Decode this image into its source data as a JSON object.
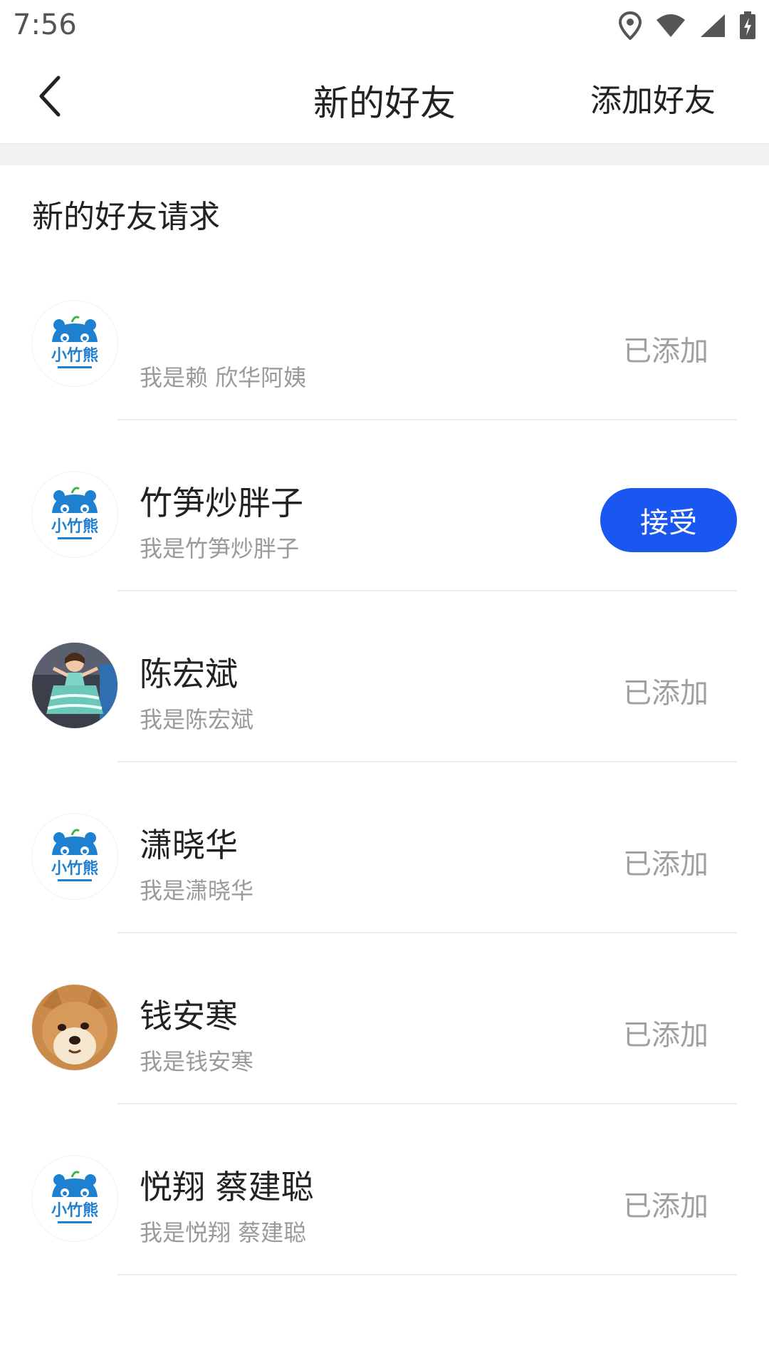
{
  "status_bar": {
    "time": "7:56",
    "icons": [
      "location-icon",
      "wifi-icon",
      "signal-icon",
      "battery-charging-icon"
    ]
  },
  "nav": {
    "back_icon": "chevron-left-icon",
    "title": "新的好友",
    "action_label": "添加好友"
  },
  "section": {
    "title": "新的好友请求"
  },
  "requests": [
    {
      "name": "",
      "message": "我是赖 欣华阿姨",
      "avatar": "xiaozhuxiong-logo",
      "status": "已添加"
    },
    {
      "name": "竹笋炒胖子",
      "message": "我是竹笋炒胖子",
      "avatar": "xiaozhuxiong-logo",
      "action": "接受"
    },
    {
      "name": "陈宏斌",
      "message": "我是陈宏斌",
      "avatar": "doll-photo",
      "status": "已添加"
    },
    {
      "name": "潇晓华",
      "message": "我是潇晓华",
      "avatar": "xiaozhuxiong-logo",
      "status": "已添加"
    },
    {
      "name": "钱安寒",
      "message": "我是钱安寒",
      "avatar": "shiba-dog-photo",
      "status": "已添加"
    },
    {
      "name": "悦翔 蔡建聪",
      "message": "我是悦翔 蔡建聪",
      "avatar": "xiaozhuxiong-logo",
      "status": "已添加"
    }
  ],
  "logo_text": "小竹熊",
  "colors": {
    "accent": "#1a56f0",
    "logo_blue": "#1f7fd1",
    "muted_text": "#9a9a9a"
  }
}
